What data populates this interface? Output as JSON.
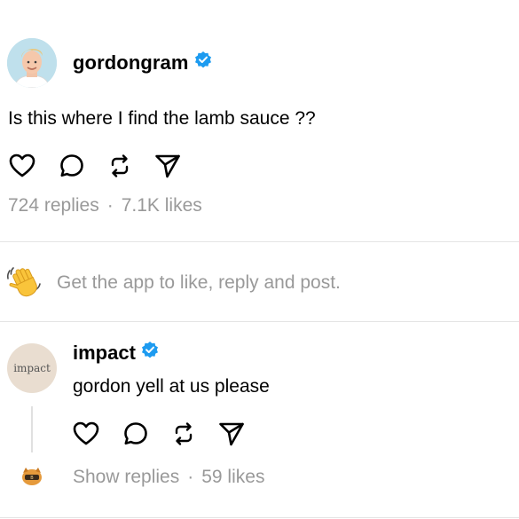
{
  "post": {
    "username": "gordongram",
    "text": "Is this where I find the lamb sauce ??",
    "replies": "724 replies",
    "separator": "·",
    "likes": "7.1K likes"
  },
  "banner": {
    "text": "Get the app to like, reply and post."
  },
  "reply": {
    "username": "impact",
    "avatar_text": "impact",
    "text": "gordon yell at us please",
    "show_replies": "Show replies",
    "separator": "·",
    "likes": "59 likes"
  },
  "icons": [
    "heart-icon",
    "comment-icon",
    "repost-icon",
    "share-icon",
    "verified-icon",
    "waving-hand-icon"
  ],
  "colors": {
    "verified": "#1d9bf0",
    "muted_text": "#999999",
    "divider": "#e4e4e4"
  }
}
